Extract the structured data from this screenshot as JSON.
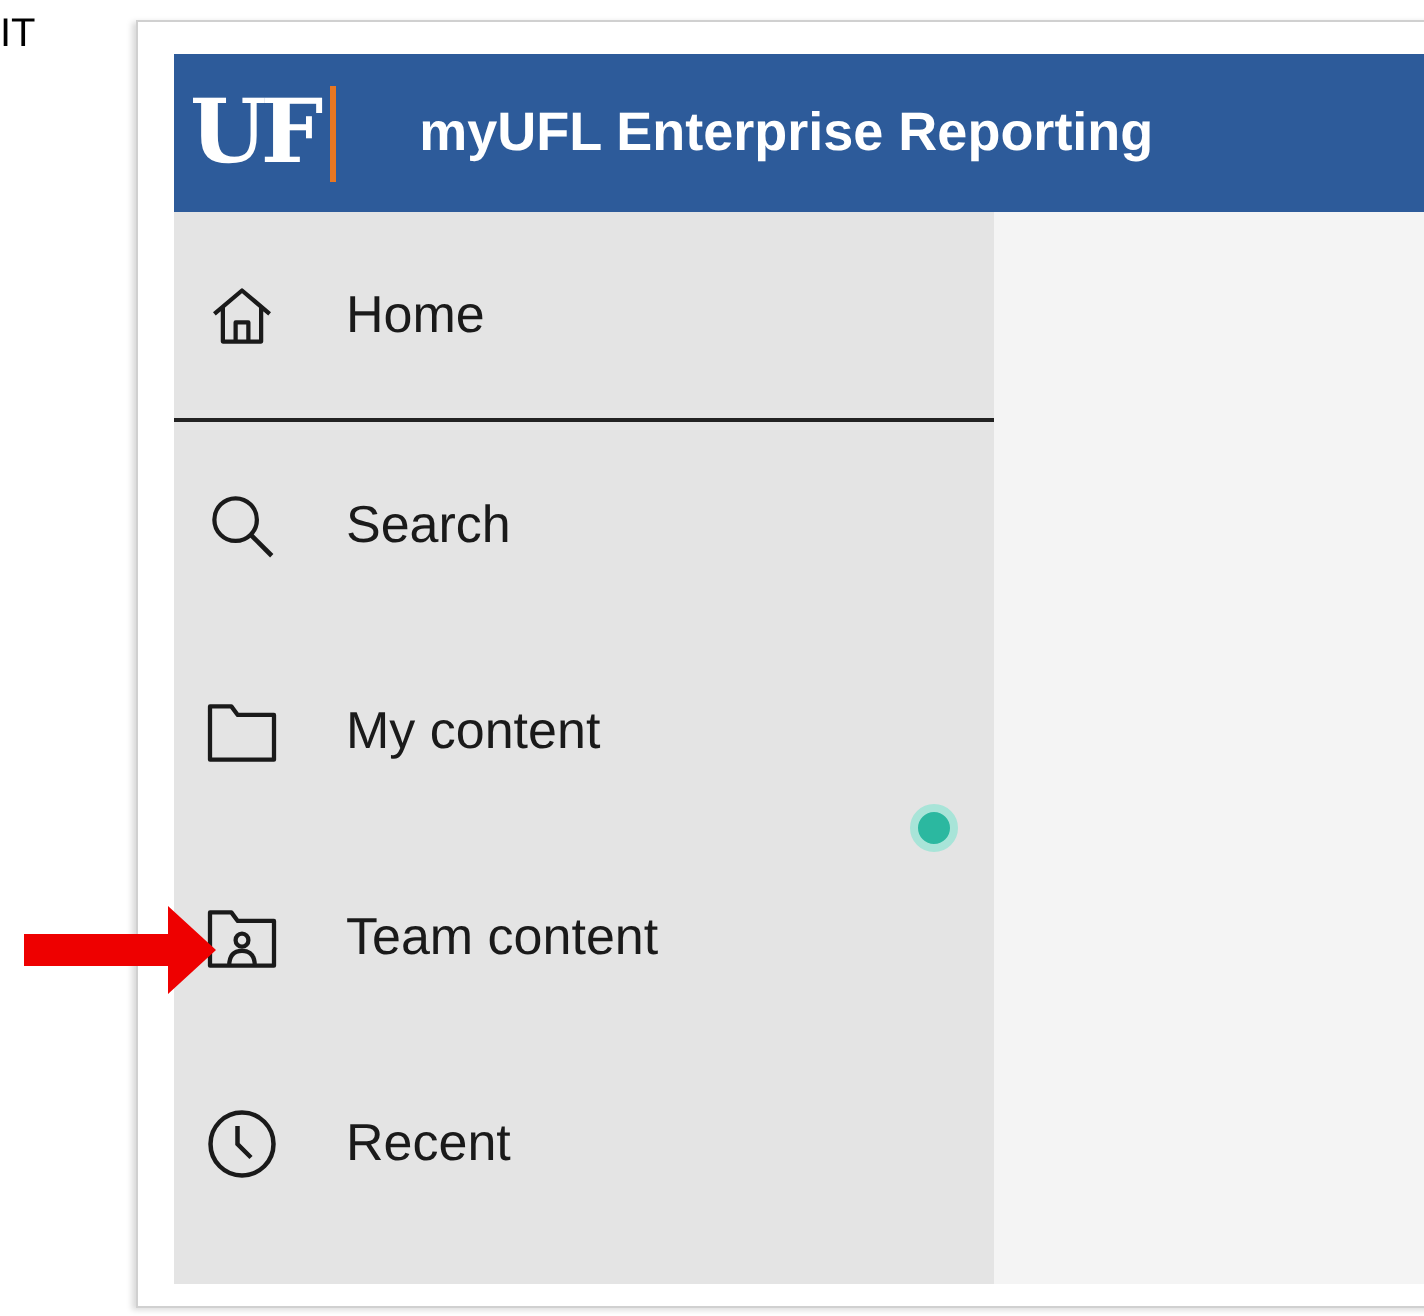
{
  "doc_text": "IT",
  "header": {
    "logo": "UF",
    "title": "myUFL Enterprise Reporting"
  },
  "nav": [
    {
      "kind": "home",
      "label": "Home",
      "selected": true
    },
    {
      "kind": "search",
      "label": "Search",
      "selected": false
    },
    {
      "kind": "folder",
      "label": "My content",
      "selected": false
    },
    {
      "kind": "team",
      "label": "Team content",
      "selected": false
    },
    {
      "kind": "clock",
      "label": "Recent",
      "selected": false
    }
  ]
}
